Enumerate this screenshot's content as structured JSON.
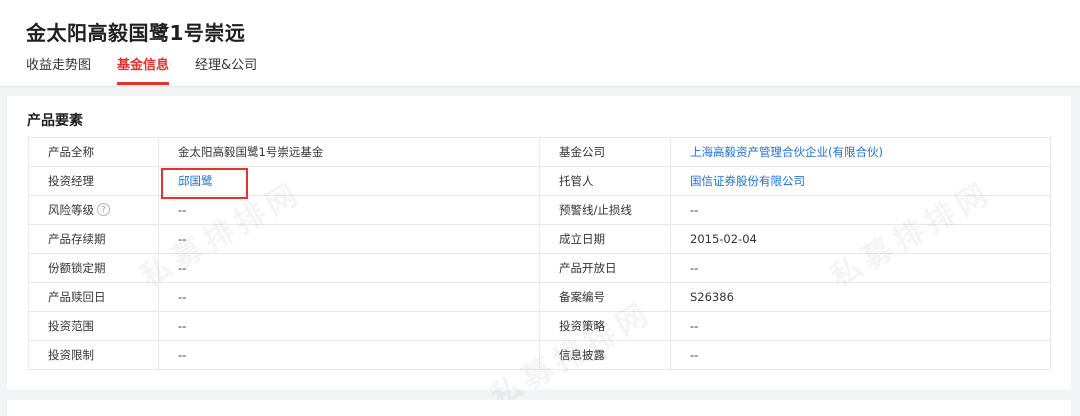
{
  "fund": {
    "title": "金太阳高毅国鹭1号崇远"
  },
  "tabs": [
    {
      "label": "收益走势图",
      "active": false
    },
    {
      "label": "基金信息",
      "active": true
    },
    {
      "label": "经理&公司",
      "active": false
    }
  ],
  "section": {
    "title": "产品要素"
  },
  "rows": [
    {
      "label1": "产品全称",
      "value1": "金太阳高毅国鹭1号崇远基金",
      "label2": "基金公司",
      "value2": "上海高毅资产管理合伙企业(有限合伙)"
    },
    {
      "label1": "投资经理",
      "value1": "邱国鹭",
      "label2": "托管人",
      "value2": "国信证券股份有限公司"
    },
    {
      "label1": "风险等级",
      "value1": "--",
      "label2": "预警线/止损线",
      "value2": "--"
    },
    {
      "label1": "产品存续期",
      "value1": "--",
      "label2": "成立日期",
      "value2": "2015-02-04"
    },
    {
      "label1": "份额锁定期",
      "value1": "--",
      "label2": "产品开放日",
      "value2": "--"
    },
    {
      "label1": "产品赎回日",
      "value1": "--",
      "label2": "备案编号",
      "value2": "S26386"
    },
    {
      "label1": "投资范围",
      "value1": "--",
      "label2": "投资策略",
      "value2": "--"
    },
    {
      "label1": "投资限制",
      "value1": "--",
      "label2": "信息披露",
      "value2": "--"
    }
  ],
  "icons": {
    "help": "?"
  },
  "colors": {
    "accent": "#e6302b",
    "link": "#1d6fd6",
    "highlight": "#e5332c"
  },
  "watermark": {
    "text": "私募排排网"
  }
}
